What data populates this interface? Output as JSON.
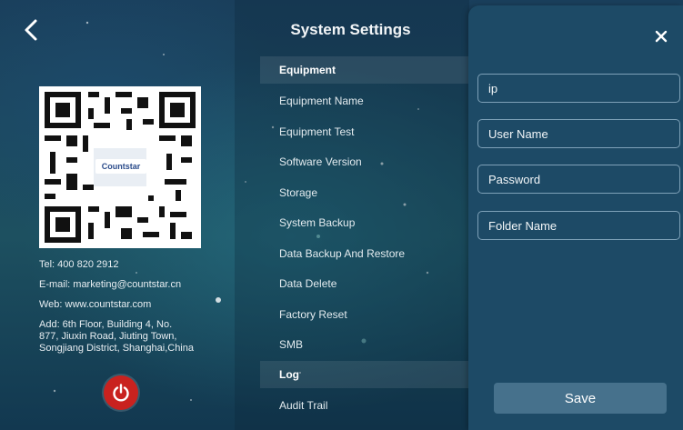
{
  "header": {
    "title": "System Settings"
  },
  "qr": {
    "logo_text": "Countstar"
  },
  "contact": {
    "tel": "Tel: 400 820 2912",
    "email": "E-mail: marketing@countstar.cn",
    "web": "Web: www.countstar.com",
    "address_line1": "Add: 6th Floor, Building 4, No.",
    "address_line2": "877, Jiuxin Road, Jiuting Town,",
    "address_line3": "Songjiang District, Shanghai,China"
  },
  "menu": {
    "section_equipment": "Equipment",
    "items": [
      "Equipment Name",
      "Equipment Test",
      "Software Version",
      "Storage",
      "System Backup",
      "Data Backup And Restore",
      "Data Delete",
      "Factory Reset",
      "SMB"
    ],
    "section_log": "Log",
    "log_items": [
      "Audit Trail"
    ]
  },
  "smb_form": {
    "ip_placeholder": "ip",
    "username_placeholder": "User Name",
    "password_placeholder": "Password",
    "folder_placeholder": "Folder Name",
    "save_label": "Save"
  },
  "icons": {
    "back": "chevron-left-icon",
    "close": "close-icon",
    "power": "power-icon"
  },
  "colors": {
    "power_button": "#c9221f",
    "panel_bg": "#1d4a66",
    "save_button": "#46718c"
  }
}
